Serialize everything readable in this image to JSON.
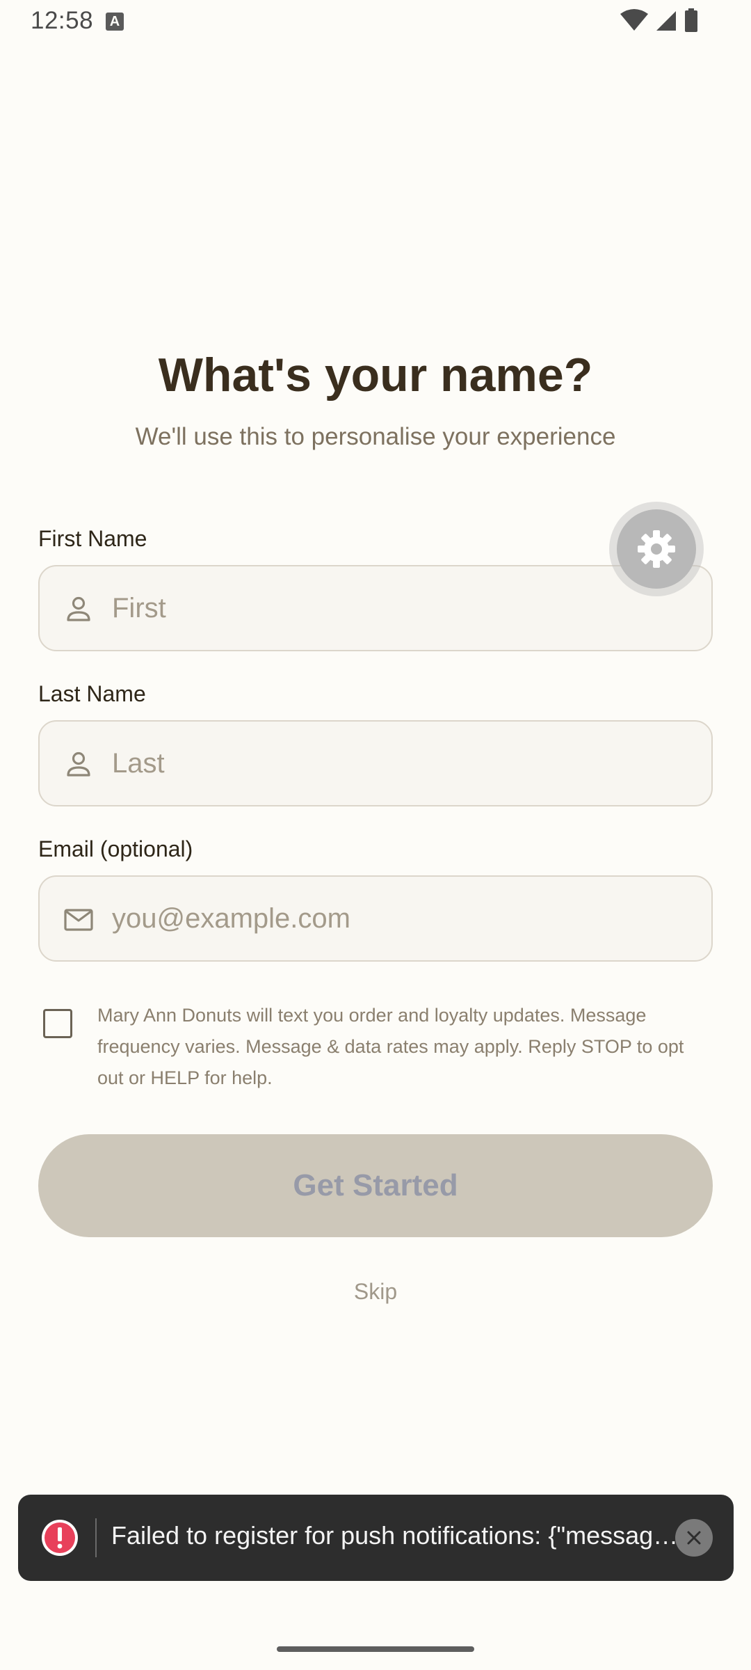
{
  "status_bar": {
    "time": "12:58",
    "notification_icon": "a-icon",
    "icons": [
      "wifi-icon",
      "signal-icon",
      "battery-icon"
    ]
  },
  "header": {
    "title": "What's your name?",
    "subtitle": "We'll use this to personalise your experience"
  },
  "form": {
    "first_name": {
      "label": "First Name",
      "placeholder": "First",
      "value": "",
      "icon": "person-icon"
    },
    "last_name": {
      "label": "Last Name",
      "placeholder": "Last",
      "value": "",
      "icon": "person-icon"
    },
    "email": {
      "label": "Email (optional)",
      "placeholder": "you@example.com",
      "value": "",
      "icon": "mail-icon"
    },
    "consent": {
      "checked": false,
      "text": "Mary Ann Donuts will text you order and loyalty updates. Message frequency varies. Message & data rates may apply. Reply STOP to opt out or HELP for help."
    },
    "submit_label": "Get Started",
    "skip_label": "Skip"
  },
  "settings_button": {
    "icon": "gear-icon"
  },
  "toast": {
    "icon": "error-icon",
    "message": "Failed to register for push notifications: {\"message\":\"Default FirebaseApp is not initialized\"}",
    "close_icon": "close-icon"
  },
  "colors": {
    "background": "#FDFCF8",
    "title": "#3A2E1E",
    "button_disabled": "#CDC7BA",
    "toast_bg": "#2D2D2D",
    "error": "#E8405A"
  }
}
